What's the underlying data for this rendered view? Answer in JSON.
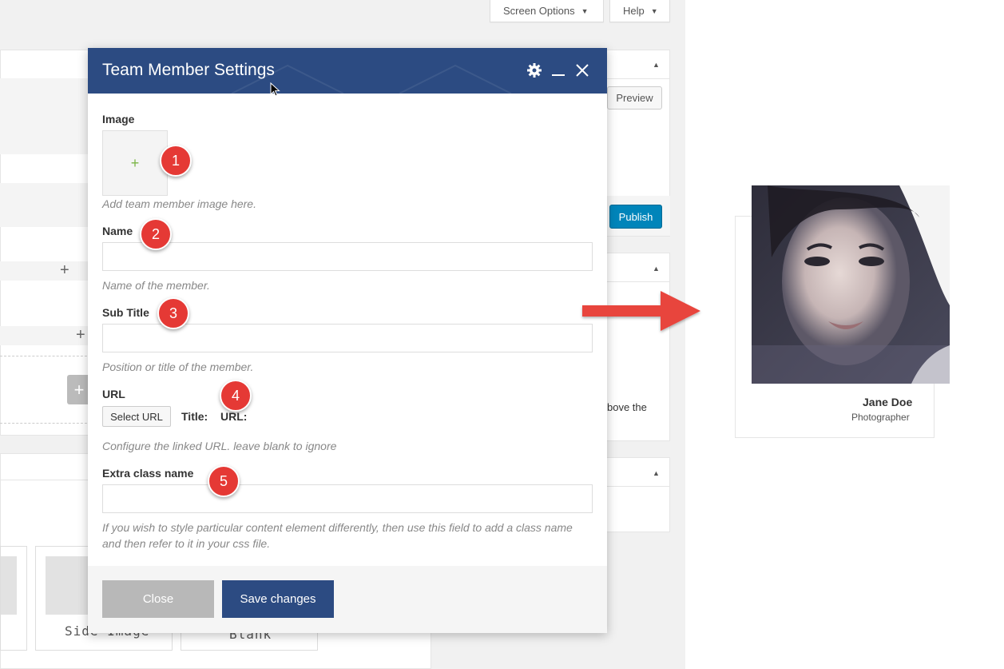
{
  "top_bar": {
    "screen_options": "Screen Options",
    "help": "Help"
  },
  "sidebar": {
    "preview": "Preview",
    "publish": "Publish",
    "partial_text": "bove the"
  },
  "templates": {
    "side_image": "Side Image",
    "blank": "Blank"
  },
  "modal": {
    "title": "Team Member Settings",
    "icons": [
      "gear-icon",
      "minimize-icon",
      "close-icon"
    ],
    "fields": {
      "image": {
        "label": "Image",
        "help": "Add team member image here.",
        "add_glyph": "+"
      },
      "name": {
        "label": "Name",
        "value": "",
        "help": "Name of the member."
      },
      "subtitle": {
        "label": "Sub Title",
        "value": "",
        "help": "Position or title of the member."
      },
      "url": {
        "label": "URL",
        "button": "Select URL",
        "title_label": "Title:",
        "url_label": "URL:",
        "help": "Configure the linked URL. leave blank to ignore"
      },
      "extra_class": {
        "label": "Extra class name",
        "value": "",
        "help": "If you wish to style particular content element differently, then use this field to add a class name and then refer to it in your css file."
      }
    },
    "footer": {
      "close": "Close",
      "save": "Save changes"
    }
  },
  "badges": [
    "1",
    "2",
    "3",
    "4",
    "5"
  ],
  "preview_card": {
    "name": "Jane Doe",
    "role": "Photographer"
  },
  "colors": {
    "modal_header": "#2c4b82",
    "badge": "#e53935",
    "arrow": "#e8453c",
    "publish": "#0085ba"
  }
}
